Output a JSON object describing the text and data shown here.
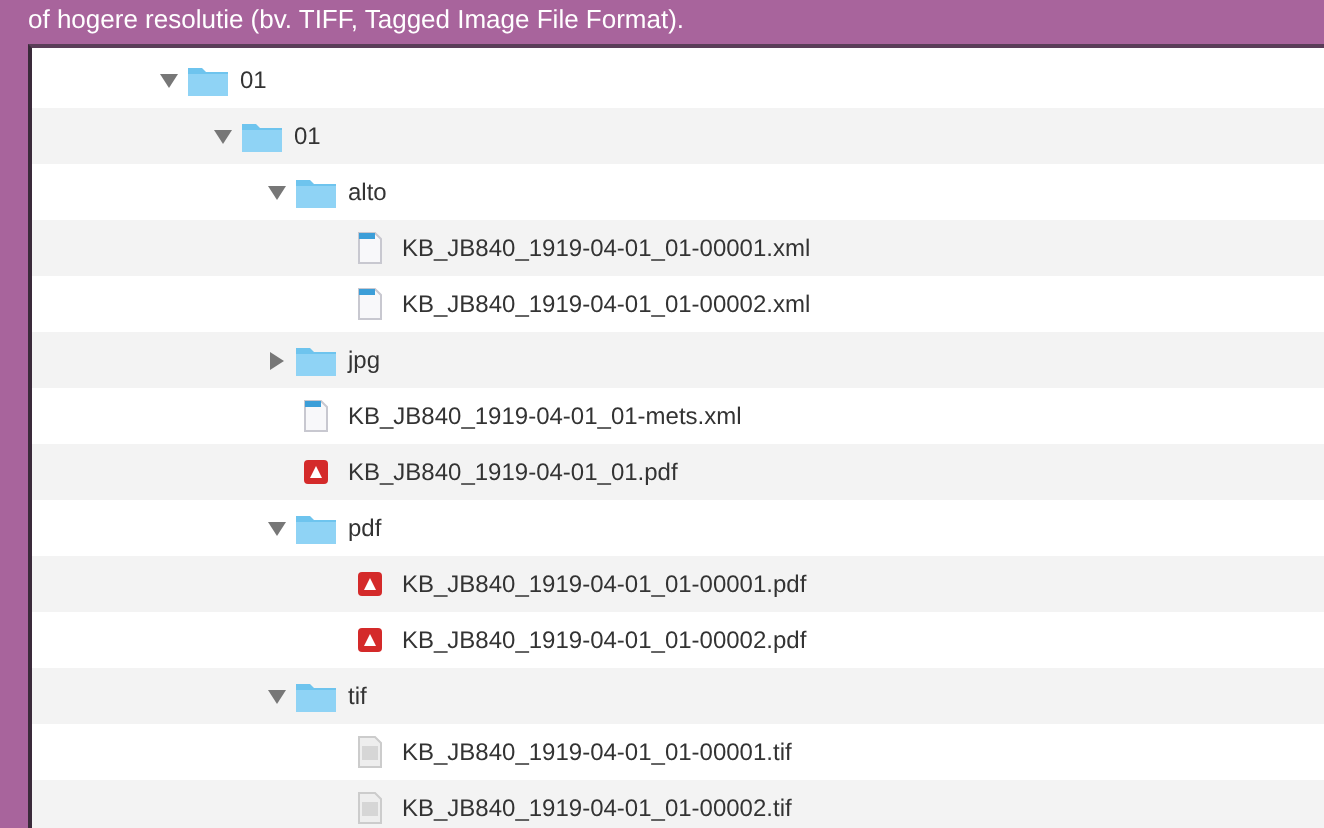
{
  "caption": "of hogere resolutie (bv. TIFF, Tagged Image File Format).",
  "tree": [
    {
      "name": "01",
      "kind": "folder",
      "expanded": true,
      "children": [
        {
          "name": "01",
          "kind": "folder",
          "expanded": true,
          "children": [
            {
              "name": "alto",
              "kind": "folder",
              "expanded": true,
              "children": [
                {
                  "name": "KB_JB840_1919-04-01_01-00001.xml",
                  "kind": "xml"
                },
                {
                  "name": "KB_JB840_1919-04-01_01-00002.xml",
                  "kind": "xml"
                }
              ]
            },
            {
              "name": "jpg",
              "kind": "folder",
              "expanded": false
            },
            {
              "name": "KB_JB840_1919-04-01_01-mets.xml",
              "kind": "xml"
            },
            {
              "name": "KB_JB840_1919-04-01_01.pdf",
              "kind": "pdf"
            },
            {
              "name": "pdf",
              "kind": "folder",
              "expanded": true,
              "children": [
                {
                  "name": "KB_JB840_1919-04-01_01-00001.pdf",
                  "kind": "pdf"
                },
                {
                  "name": "KB_JB840_1919-04-01_01-00002.pdf",
                  "kind": "pdf"
                }
              ]
            },
            {
              "name": "tif",
              "kind": "folder",
              "expanded": true,
              "children": [
                {
                  "name": "KB_JB840_1919-04-01_01-00001.tif",
                  "kind": "tif"
                },
                {
                  "name": "KB_JB840_1919-04-01_01-00002.tif",
                  "kind": "tif"
                }
              ]
            }
          ]
        }
      ]
    }
  ]
}
